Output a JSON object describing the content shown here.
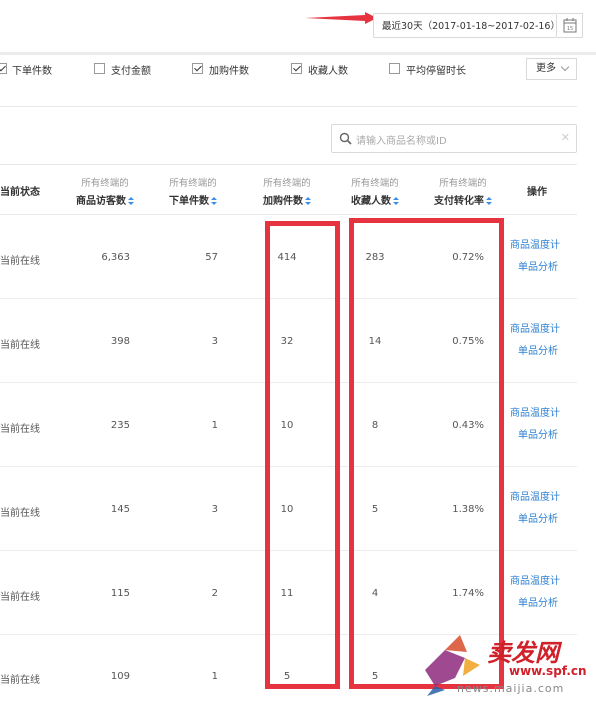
{
  "date_range": {
    "label": "最近30天（2017-01-18~2017-02-16）"
  },
  "filters": [
    {
      "label": "下单件数",
      "checked": true
    },
    {
      "label": "支付金额",
      "checked": false
    },
    {
      "label": "加购件数",
      "checked": true
    },
    {
      "label": "收藏人数",
      "checked": true
    },
    {
      "label": "平均停留时长",
      "checked": false
    }
  ],
  "more_button": {
    "label": "更多"
  },
  "search": {
    "placeholder": "请输入商品名称或ID"
  },
  "table": {
    "header_status": "当前状态",
    "header_action": "操作",
    "columns": [
      {
        "top": "所有终端的",
        "bottom": "商品访客数"
      },
      {
        "top": "所有终端的",
        "bottom": "下单件数"
      },
      {
        "top": "所有终端的",
        "bottom": "加购件数"
      },
      {
        "top": "所有终端的",
        "bottom": "收藏人数"
      },
      {
        "top": "所有终端的",
        "bottom": "支付转化率"
      }
    ],
    "rows": [
      {
        "status": "当前在线",
        "visitors": "6,363",
        "orders": "57",
        "cart": "414",
        "favs": "283",
        "rate": "0.72%"
      },
      {
        "status": "当前在线",
        "visitors": "398",
        "orders": "3",
        "cart": "32",
        "favs": "14",
        "rate": "0.75%"
      },
      {
        "status": "当前在线",
        "visitors": "235",
        "orders": "1",
        "cart": "10",
        "favs": "8",
        "rate": "0.43%"
      },
      {
        "status": "当前在线",
        "visitors": "145",
        "orders": "3",
        "cart": "10",
        "favs": "5",
        "rate": "1.38%"
      },
      {
        "status": "当前在线",
        "visitors": "115",
        "orders": "2",
        "cart": "11",
        "favs": "4",
        "rate": "1.74%"
      },
      {
        "status": "当前在线",
        "visitors": "109",
        "orders": "1",
        "cart": "5",
        "favs": "5",
        "rate": ""
      }
    ],
    "action_links": {
      "temperature": "商品温度计",
      "analysis": "单品分析"
    }
  },
  "watermark": {
    "text": "卖发网",
    "url": "www.spf.cn",
    "sub": "news.maijia.com"
  },
  "colors": {
    "accent": "#2f80d0",
    "highlight": "#e5343f",
    "arrow": "#e5343f"
  }
}
